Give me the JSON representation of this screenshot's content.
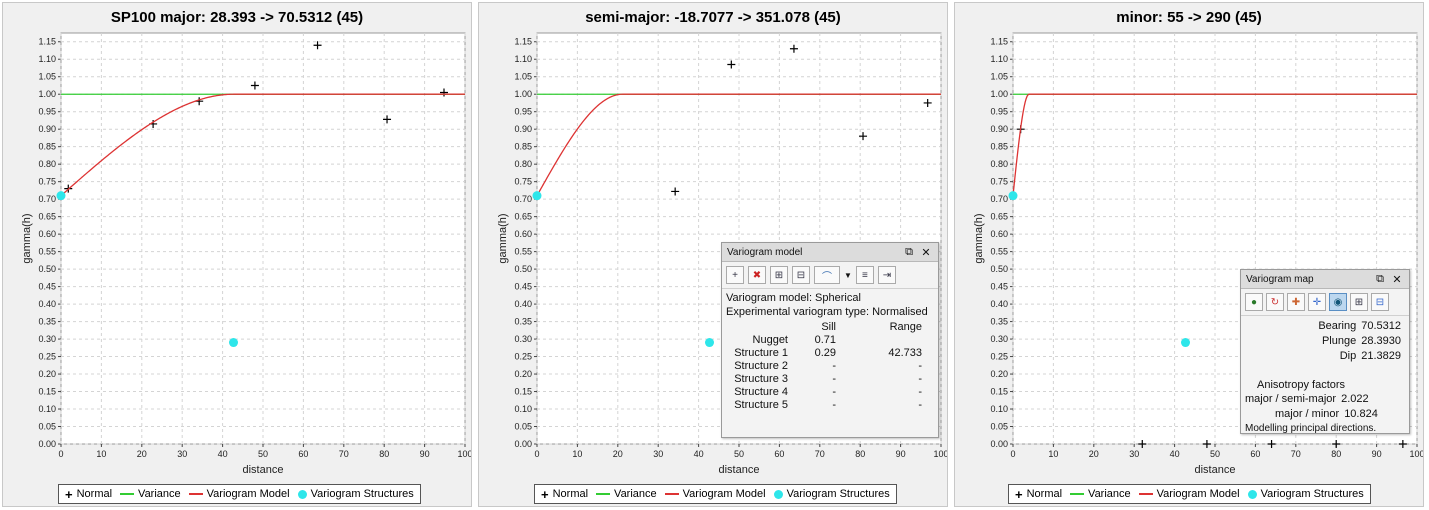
{
  "legend": {
    "normal": "Normal",
    "variance": "Variance",
    "model": "Variogram Model",
    "structures": "Variogram Structures"
  },
  "colors": {
    "variance": "#33cc33",
    "model": "#dd3333",
    "structures": "#2ee6ea",
    "points": "#000000",
    "grid": "#d4d4d4"
  },
  "chart_data": [
    {
      "type": "scatter",
      "title": "SP100 major: 28.393 -> 70.5312 (45)",
      "xlabel": "distance",
      "ylabel": "gamma(h)",
      "xlim": [
        0,
        100
      ],
      "ylim": [
        0,
        1.15
      ],
      "xticks": [
        "0",
        "10",
        "20",
        "30",
        "40",
        "50",
        "60",
        "70",
        "80",
        "90",
        "100"
      ],
      "yticks": [
        "0.00",
        "0.05",
        "0.10",
        "0.15",
        "0.20",
        "0.25",
        "0.30",
        "0.35",
        "0.40",
        "0.45",
        "0.50",
        "0.55",
        "0.60",
        "0.65",
        "0.70",
        "0.75",
        "0.80",
        "0.85",
        "0.90",
        "0.95",
        "1.00",
        "1.05",
        "1.10",
        "1.15"
      ],
      "grid": true,
      "series": [
        {
          "name": "Normal",
          "kind": "points",
          "x": [
            1.8,
            22.8,
            34.2,
            48,
            63.5,
            80.7,
            94.8
          ],
          "y": [
            0.73,
            0.915,
            0.98,
            1.025,
            1.14,
            0.928,
            1.005
          ]
        },
        {
          "name": "Variance",
          "kind": "hline",
          "y": 1.0
        },
        {
          "name": "Variogram Model",
          "kind": "spherical",
          "nugget": 0.71,
          "sill": 0.29,
          "range": 42.733
        },
        {
          "name": "Variogram Structures",
          "kind": "dots",
          "x": [
            0,
            42.7
          ],
          "y": [
            0.71,
            0.29
          ]
        }
      ]
    },
    {
      "type": "scatter",
      "title": "semi-major: -18.7077 -> 351.078 (45)",
      "xlabel": "distance",
      "ylabel": "gamma(h)",
      "xlim": [
        0,
        100
      ],
      "ylim": [
        0,
        1.15
      ],
      "xticks": [
        "0",
        "10",
        "20",
        "30",
        "40",
        "50",
        "60",
        "70",
        "80",
        "90",
        "100"
      ],
      "yticks": [
        "0.00",
        "0.05",
        "0.10",
        "0.15",
        "0.20",
        "0.25",
        "0.30",
        "0.35",
        "0.40",
        "0.45",
        "0.50",
        "0.55",
        "0.60",
        "0.65",
        "0.70",
        "0.75",
        "0.80",
        "0.85",
        "0.90",
        "0.95",
        "1.00",
        "1.05",
        "1.10",
        "1.15"
      ],
      "grid": true,
      "series": [
        {
          "name": "Normal",
          "kind": "points",
          "x": [
            34.2,
            48.1,
            63.6,
            80.7,
            96.7
          ],
          "y": [
            0.722,
            1.085,
            1.13,
            0.88,
            0.975
          ]
        },
        {
          "name": "Variance",
          "kind": "hline",
          "y": 1.0
        },
        {
          "name": "Variogram Model",
          "kind": "spherical",
          "nugget": 0.71,
          "sill": 0.29,
          "range": 21.13
        },
        {
          "name": "Variogram Structures",
          "kind": "dots",
          "x": [
            0,
            42.7
          ],
          "y": [
            0.71,
            0.29
          ]
        }
      ]
    },
    {
      "type": "scatter",
      "title": "minor: 55 -> 290 (45)",
      "xlabel": "distance",
      "ylabel": "gamma(h)",
      "xlim": [
        0,
        100
      ],
      "ylim": [
        0,
        1.15
      ],
      "xticks": [
        "0",
        "10",
        "20",
        "30",
        "40",
        "50",
        "60",
        "70",
        "80",
        "90",
        "100"
      ],
      "yticks": [
        "0.00",
        "0.05",
        "0.10",
        "0.15",
        "0.20",
        "0.25",
        "0.30",
        "0.35",
        "0.40",
        "0.45",
        "0.50",
        "0.55",
        "0.60",
        "0.65",
        "0.70",
        "0.75",
        "0.80",
        "0.85",
        "0.90",
        "0.95",
        "1.00",
        "1.05",
        "1.10",
        "1.15"
      ],
      "grid": true,
      "series": [
        {
          "name": "Normal",
          "kind": "points",
          "x": [
            1.9,
            32,
            48,
            64,
            80,
            96.5
          ],
          "y": [
            0.9,
            0.0,
            0.0,
            0.0,
            0.0,
            0.0
          ]
        },
        {
          "name": "Variance",
          "kind": "hline",
          "y": 1.0
        },
        {
          "name": "Variogram Model",
          "kind": "spherical",
          "nugget": 0.71,
          "sill": 0.29,
          "range": 3.95
        },
        {
          "name": "Variogram Structures",
          "kind": "dots",
          "x": [
            0,
            42.7
          ],
          "y": [
            0.71,
            0.29
          ]
        }
      ]
    }
  ],
  "model_dialog": {
    "title": "Variogram model",
    "model_line": "Variogram model: Spherical",
    "type_line": "Experimental variogram type: Normalised",
    "col_sill": "Sill",
    "col_range": "Range",
    "rows": [
      {
        "name": "Nugget",
        "sill": "0.71",
        "range": ""
      },
      {
        "name": "Structure 1",
        "sill": "0.29",
        "range": "42.733"
      },
      {
        "name": "Structure 2",
        "sill": "-",
        "range": "-"
      },
      {
        "name": "Structure 3",
        "sill": "-",
        "range": "-"
      },
      {
        "name": "Structure 4",
        "sill": "-",
        "range": "-"
      },
      {
        "name": "Structure 5",
        "sill": "-",
        "range": "-"
      }
    ]
  },
  "map_dialog": {
    "title": "Variogram map",
    "bearing_label": "Bearing",
    "bearing": "70.5312",
    "plunge_label": "Plunge",
    "plunge": "28.3930",
    "dip_label": "Dip",
    "dip": "21.3829",
    "aniso_header": "Anisotropy factors",
    "ratio1_label": "major / semi-major",
    "ratio1": "2.022",
    "ratio2_label": "major / minor",
    "ratio2": "10.824",
    "status": "Modelling principal directions."
  }
}
